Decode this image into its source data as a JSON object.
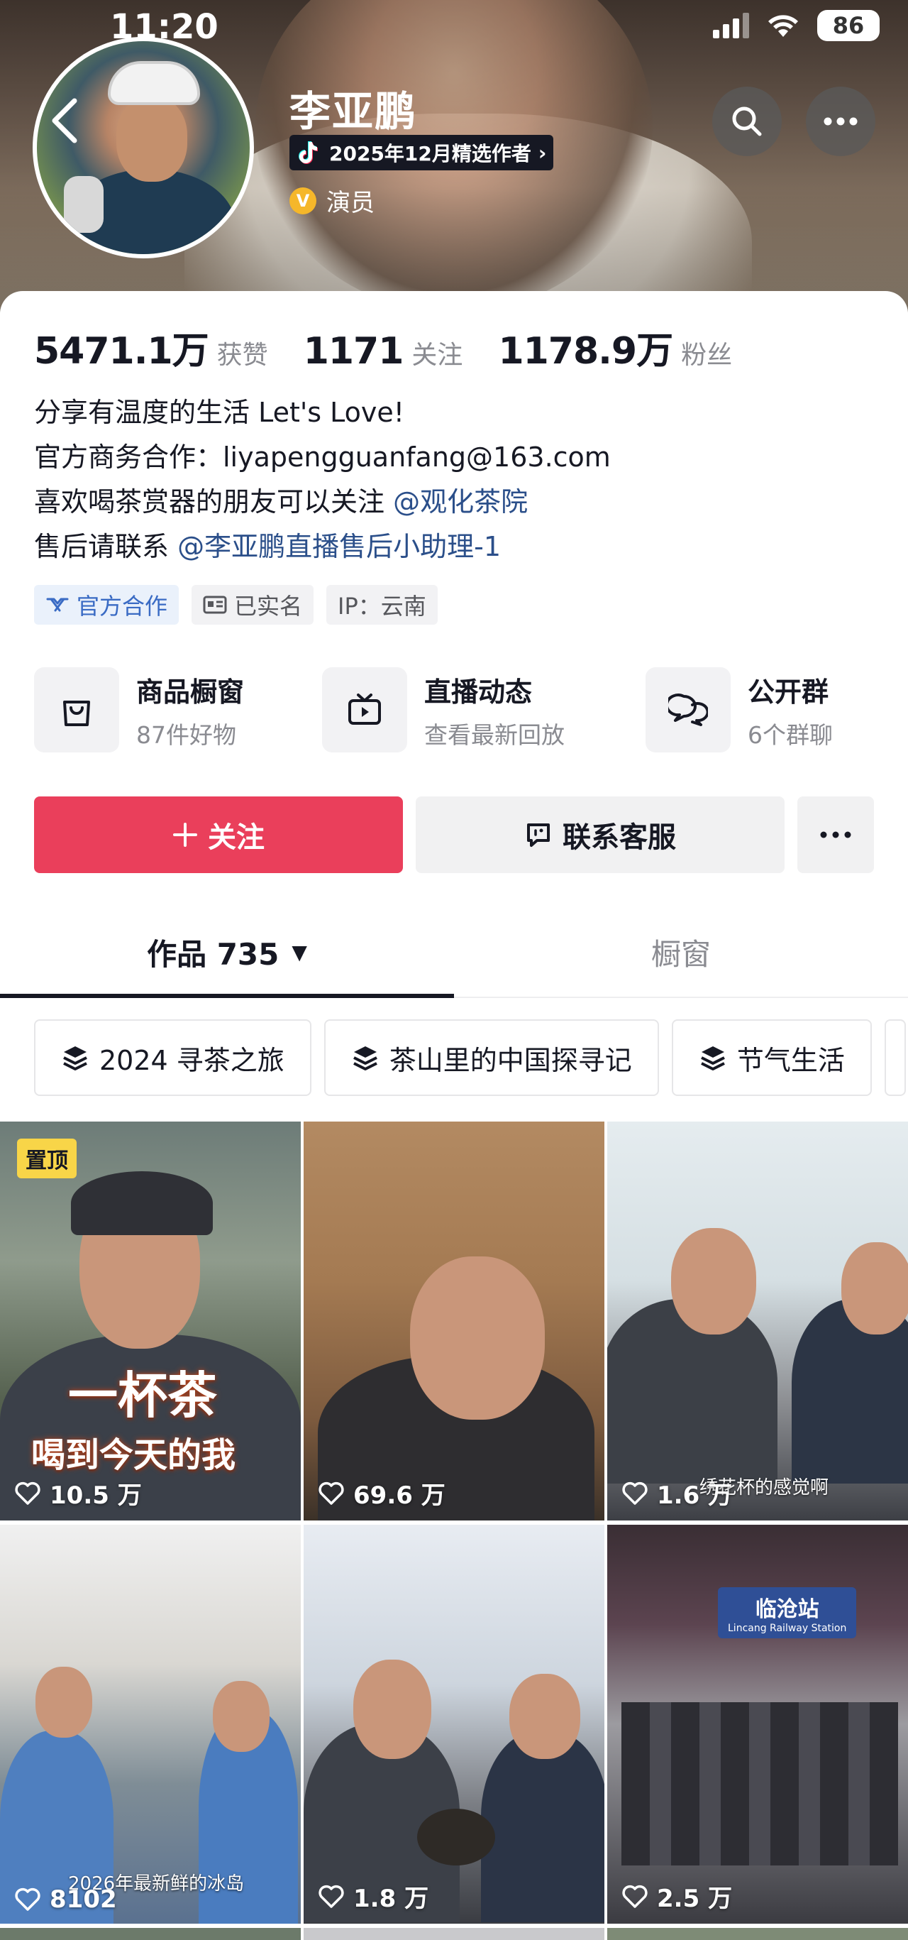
{
  "status_bar": {
    "time": "11:20",
    "battery": "86"
  },
  "profile": {
    "name": "李亚鹏",
    "badge": "2025年12月精选作者",
    "role": "演员",
    "role_mark": "V"
  },
  "stats": [
    {
      "value": "5471.1万",
      "label": "获赞"
    },
    {
      "value": "1171",
      "label": "关注"
    },
    {
      "value": "1178.9万",
      "label": "粉丝"
    }
  ],
  "bio": {
    "line1": "分享有温度的生活 Let's Love!",
    "line2": "官方商务合作：liyapengguanfang@163.com",
    "line3_text": "喜欢喝茶赏器的朋友可以关注",
    "line3_mention": "@观化茶院",
    "line4_text": "售后请联系",
    "line4_mention": "@李亚鹏直播售后小助理-1"
  },
  "tags": [
    "官方合作",
    "已实名",
    "IP：云南"
  ],
  "features": [
    {
      "title": "商品橱窗",
      "subtitle": "87件好物",
      "icon": "bag-icon"
    },
    {
      "title": "直播动态",
      "subtitle": "查看最新回放",
      "icon": "tv-icon"
    },
    {
      "title": "公开群",
      "subtitle": "6个群聊",
      "icon": "chat-icon"
    }
  ],
  "actions": {
    "follow": "关注",
    "contact": "联系客服"
  },
  "tabs": {
    "works": "作品 735",
    "showcase": "橱窗"
  },
  "collections": [
    "2024 寻茶之旅",
    "茶山里的中国探寻记",
    "节气生活"
  ],
  "videos": [
    {
      "likes": "10.5 万",
      "pinned_label": "置顶",
      "overlay_title_1": "一杯茶",
      "overlay_title_2": "喝到今天的我"
    },
    {
      "likes": "69.6 万"
    },
    {
      "likes": "1.6 万",
      "caption": "绣花杯的感觉啊"
    },
    {
      "likes": "8102",
      "caption": "2026年最新鲜的冰岛"
    },
    {
      "likes": "1.8 万"
    },
    {
      "likes": "2.5 万",
      "station_cn": "临沧站",
      "station_en": "Lincang Railway Station"
    }
  ],
  "colors": {
    "follow": "#ea3f5b",
    "mention": "#2b4f8a",
    "official_tag": "#3a6bc4",
    "pin_badge": "#f8d548"
  }
}
